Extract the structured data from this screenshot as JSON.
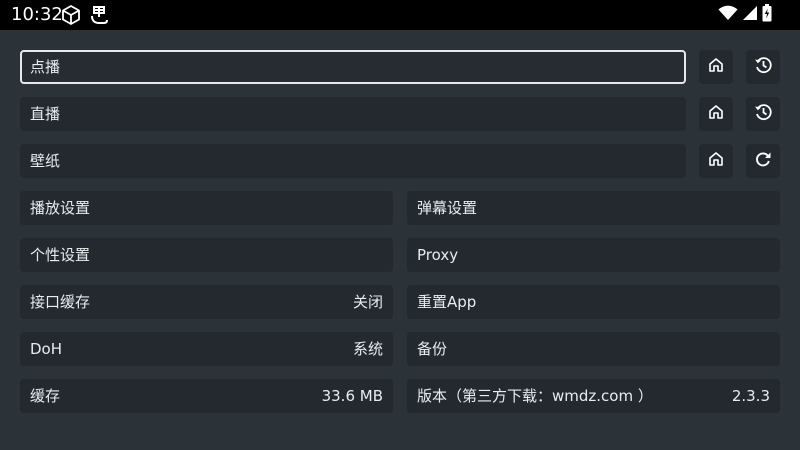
{
  "status_bar": {
    "time": "10:32",
    "icons": [
      "cube-icon",
      "app-ghost-icon",
      "wifi-icon",
      "signal-icon",
      "battery-charging-icon"
    ]
  },
  "inputs": [
    {
      "label": "点播",
      "buttons": [
        "home-icon",
        "history-icon"
      ]
    },
    {
      "label": "直播",
      "buttons": [
        "home-icon",
        "history-icon"
      ]
    },
    {
      "label": "壁纸",
      "buttons": [
        "home-icon",
        "refresh-icon"
      ]
    }
  ],
  "settings": {
    "left": [
      {
        "label": "播放设置",
        "value": ""
      },
      {
        "label": "个性设置",
        "value": ""
      },
      {
        "label": "接口缓存",
        "value": "关闭"
      },
      {
        "label": "DoH",
        "value": "系统"
      },
      {
        "label": "缓存",
        "value": "33.6 MB"
      }
    ],
    "right": [
      {
        "label": "弹幕设置",
        "value": ""
      },
      {
        "label": "Proxy",
        "value": ""
      },
      {
        "label": "重置App",
        "value": ""
      },
      {
        "label": "备份",
        "value": ""
      },
      {
        "label": "版本（第三方下载：wmdz.com ）",
        "value": "2.3.3"
      }
    ]
  },
  "colors": {
    "background": "#2b3238",
    "tile": "#23292f",
    "text": "#e9ecef",
    "focus_border": "#e6e9ec"
  }
}
